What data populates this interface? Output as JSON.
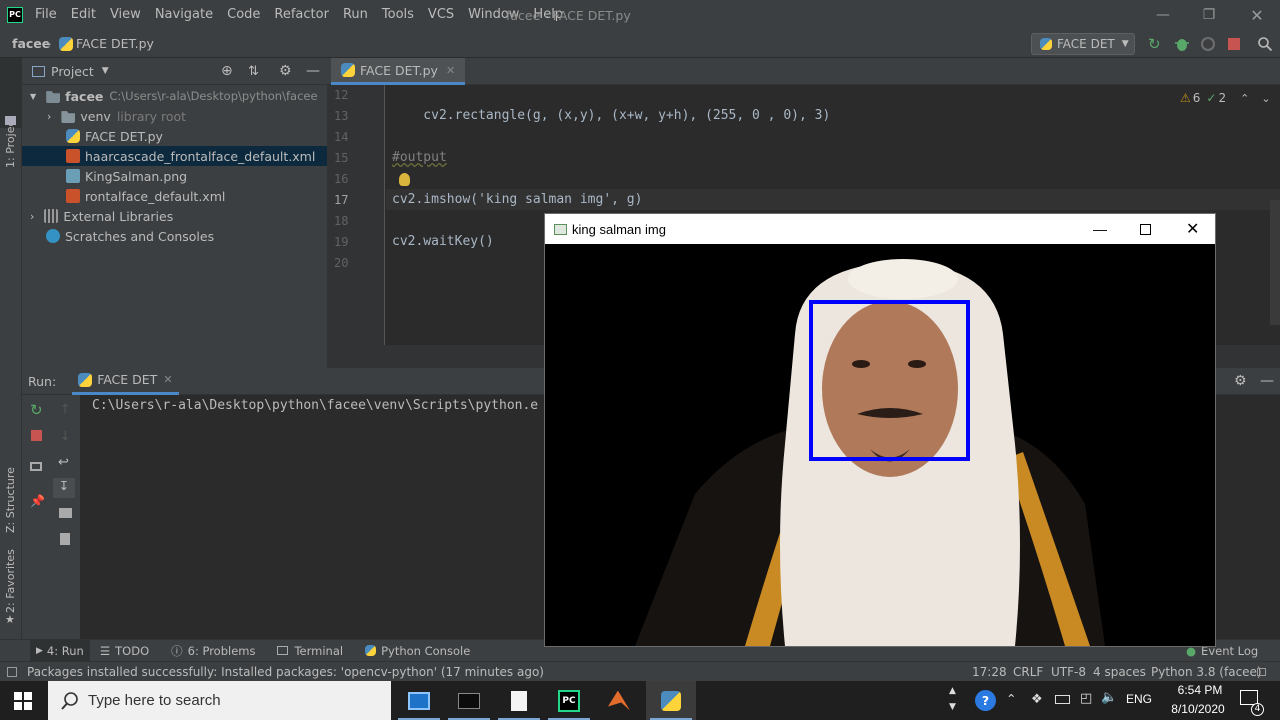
{
  "menu": [
    "File",
    "Edit",
    "View",
    "Navigate",
    "Code",
    "Refactor",
    "Run",
    "Tools",
    "VCS",
    "Window",
    "Help"
  ],
  "window_title": "facee - FACE DET.py",
  "nav": {
    "project": "facee",
    "file": "FACE DET.py",
    "run_config": "FACE DET"
  },
  "project_panel": {
    "title": "Project",
    "tree": [
      {
        "label": "facee",
        "hint": "C:\\Users\\r-ala\\Desktop\\python\\facee"
      },
      {
        "label": "venv",
        "hint": "library root"
      },
      {
        "label": "FACE DET.py"
      },
      {
        "label": "haarcascade_frontalface_default.xml",
        "selected": true
      },
      {
        "label": "KingSalman.png"
      },
      {
        "label": "rontalface_default.xml"
      },
      {
        "label": "External Libraries"
      },
      {
        "label": "Scratches and Consoles"
      }
    ]
  },
  "left_strip": {
    "project": "1: Project",
    "structure": "Z: Structure",
    "favorites": "2: Favorites"
  },
  "editor": {
    "tab": "FACE DET.py",
    "inspections": {
      "warnings": "6",
      "weak": "2"
    },
    "lines": [
      {
        "n": "12",
        "code": ""
      },
      {
        "n": "13",
        "code": "    cv2.rectangle(g, (x,y), (x+w, y+h), (255, 0 , 0), 3)"
      },
      {
        "n": "14",
        "code": ""
      },
      {
        "n": "15",
        "code": "#output"
      },
      {
        "n": "16",
        "code": ""
      },
      {
        "n": "17",
        "code": "cv2.imshow('king salman img', g)"
      },
      {
        "n": "18",
        "code": ""
      },
      {
        "n": "19",
        "code": "cv2.waitKey()"
      },
      {
        "n": "20",
        "code": ""
      }
    ]
  },
  "run_panel": {
    "label": "Run:",
    "tab": "FACE DET",
    "console": "C:\\Users\\r-ala\\Desktop\\python\\facee\\venv\\Scripts\\python.e"
  },
  "bottom_tabs": [
    "4: Run",
    "TODO",
    "6: Problems",
    "Terminal",
    "Python Console"
  ],
  "event_log": "Event Log",
  "status": {
    "message": "Packages installed successfully: Installed packages: 'opencv-python' (17 minutes ago)",
    "position": "17:28",
    "line_sep": "CRLF",
    "encoding": "UTF-8",
    "indent": "4 spaces",
    "interpreter": "Python 3.8 (facee)"
  },
  "cv_window": {
    "title": "king salman img"
  },
  "taskbar": {
    "search_placeholder": "Type here to search",
    "lang": "ENG",
    "time": "6:54 PM",
    "date": "8/10/2020",
    "notifications": "4"
  }
}
